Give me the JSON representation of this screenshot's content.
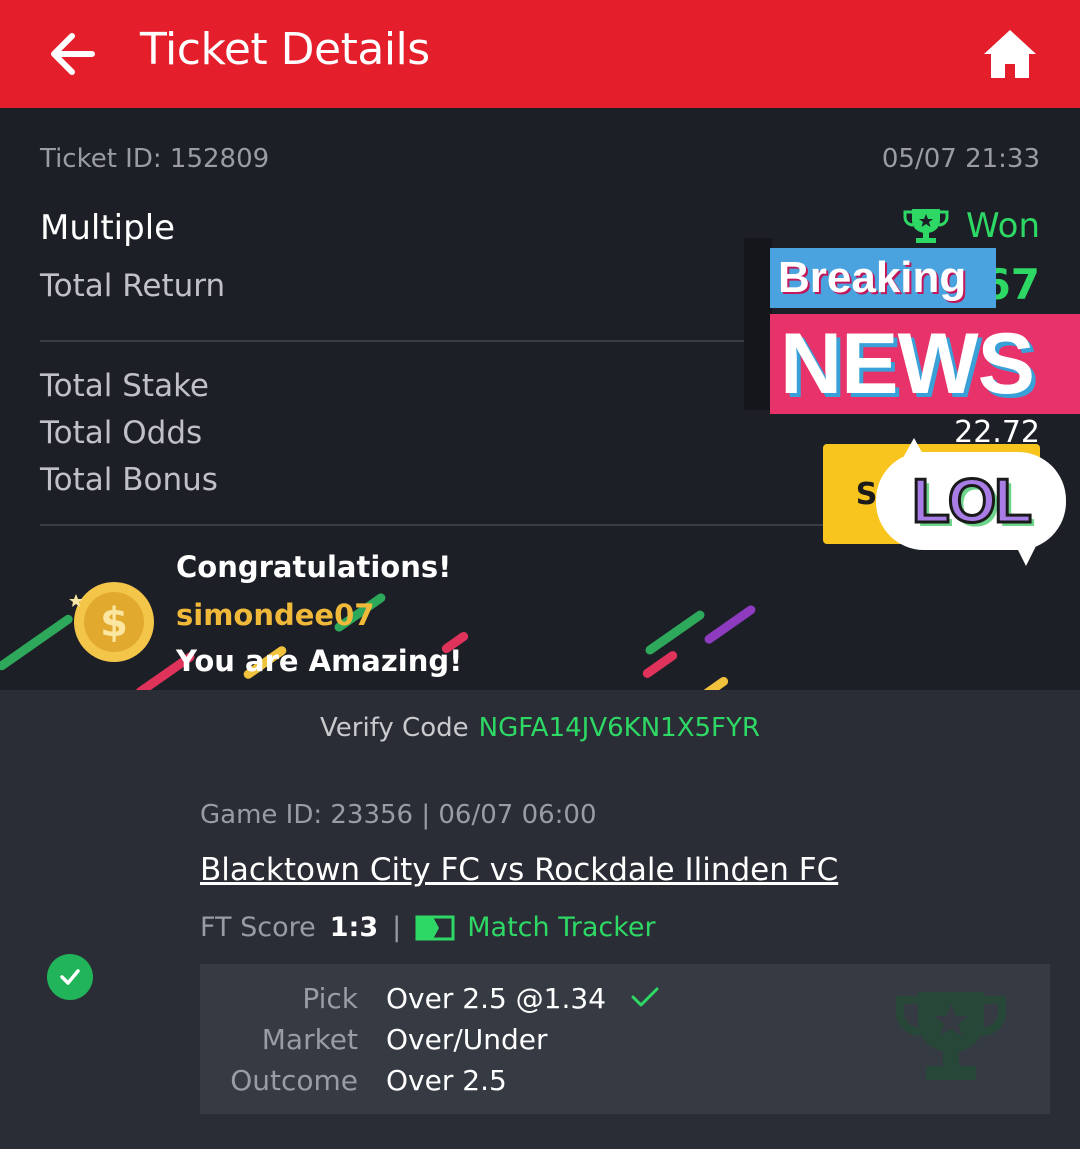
{
  "header": {
    "title": "Ticket Details",
    "back_icon": "arrow-left-icon",
    "home_icon": "home-icon",
    "color": "#e41e2b"
  },
  "ticket": {
    "id_text": "Ticket ID: 152809",
    "date": "05/07 21:33",
    "type": "Multiple",
    "status": "Won",
    "status_color": "#2ed865",
    "total_return_label": "Total Return",
    "total_return_value": "67",
    "total_stake_label": "Total Stake",
    "total_odds_label": "Total Odds",
    "total_odds_value": "22.72",
    "total_bonus_label": "Total Bonus"
  },
  "congrats": {
    "line1": "Congratulations!",
    "username": "simondee07",
    "line3": "You are Amazing!",
    "show_off_label": "Show Off",
    "show_off_color": "#f7c51d"
  },
  "verify": {
    "label": "Verify Code",
    "code": "NGFA14JV6KN1X5FYR"
  },
  "game": {
    "id_text": "Game ID: 23356 | 06/07 06:00",
    "match": "Blacktown City FC vs Rockdale Ilinden FC",
    "score_label": "FT Score",
    "score": "1:3",
    "separator": "|",
    "tracker_label": "Match Tracker",
    "pick_label": "Pick",
    "pick_value": "Over 2.5 @1.34",
    "market_label": "Market",
    "market_value": "Over/Under",
    "outcome_label": "Outcome",
    "outcome_value": "Over 2.5"
  },
  "stickers": {
    "breaking": "Breaking",
    "news": "NEWS",
    "lol": "LOL"
  }
}
